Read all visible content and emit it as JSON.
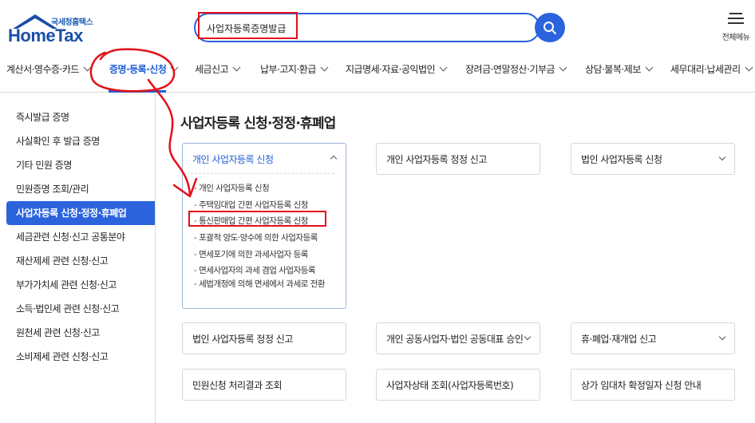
{
  "header": {
    "logo_sub": "국세청홈택스",
    "logo_main": "HomeTax",
    "search": {
      "value": "사업자등록증명발급"
    },
    "menu_all_label": "전체메뉴"
  },
  "nav": {
    "items": [
      {
        "label": "계산서·영수증·카드"
      },
      {
        "label": "증명·등록·신청"
      },
      {
        "label": "세금신고"
      },
      {
        "label": "납부·고지·환급"
      },
      {
        "label": "지급명세·자료·공익법인"
      },
      {
        "label": "장려금·연말정산·기부금"
      },
      {
        "label": "상담·불복·제보"
      },
      {
        "label": "세무대리·납세관리"
      }
    ]
  },
  "sidebar": {
    "items": [
      {
        "label": "즉시발급 증명"
      },
      {
        "label": "사실확인 후 발급 증명"
      },
      {
        "label": "기타 민원 증명"
      },
      {
        "label": "민원증명 조회/관리"
      },
      {
        "label": "사업자등록 신청·정정·휴폐업"
      },
      {
        "label": "세금관련 신청·신고 공통분야"
      },
      {
        "label": "재산제세 관련 신청·신고"
      },
      {
        "label": "부가가치세 관련 신청·신고"
      },
      {
        "label": "소득·법인세 관련 신청·신고"
      },
      {
        "label": "원천세 관련 신청·신고"
      },
      {
        "label": "소비제세 관련 신청·신고"
      }
    ]
  },
  "main": {
    "title": "사업자등록 신청·정정·휴폐업",
    "cards": [
      {
        "label": "개인 사업자등록 신청",
        "sub_items": [
          "개인 사업자등록 신청",
          "주택임대업 간편 사업자등록 신청",
          "통신판매업 간편 사업자등록 신청",
          "포괄적 양도·양수에 의한 사업자등록",
          "면세포기에 의한 과세사업자 등록",
          "면세사업자의 과세 겸업 사업자등록",
          "세법개정에 의해 면세에서 과세로 전환"
        ]
      },
      {
        "label": "개인 사업자등록 정정 신고"
      },
      {
        "label": "법인 사업자등록 신청"
      },
      {
        "label": "법인 사업자등록 정정 신고"
      },
      {
        "label": "개인 공동사업자·법인 공동대표 승인"
      },
      {
        "label": "휴·폐업·재개업 신고"
      },
      {
        "label": "민원신청 처리결과 조회"
      },
      {
        "label": "사업자상태 조회(사업자등록번호)"
      },
      {
        "label": "상가 임대차 확정일자 신청 안내"
      }
    ]
  },
  "colors": {
    "brand_blue": "#1a4fa8",
    "accent_blue": "#2b63dd",
    "highlight_red": "#e3101a"
  }
}
